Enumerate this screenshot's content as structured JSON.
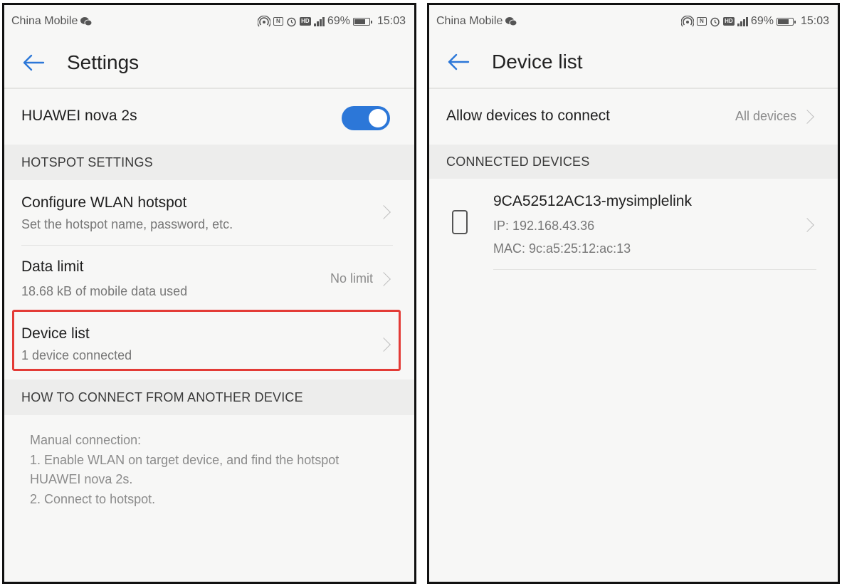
{
  "status_bar": {
    "carrier": "China Mobile",
    "battery_percent": "69%",
    "time": "15:03"
  },
  "left_screen": {
    "title": "Settings",
    "hotspot_name_row": {
      "label": "HUAWEI nova 2s",
      "toggle_on": true
    },
    "hotspot_settings_header": "HOTSPOT SETTINGS",
    "configure_wlan": {
      "title": "Configure WLAN hotspot",
      "subtitle": "Set the hotspot name, password, etc."
    },
    "data_limit": {
      "title": "Data limit",
      "subtitle": "18.68 kB of mobile data used",
      "value": "No limit"
    },
    "device_list": {
      "title": "Device list",
      "subtitle": "1 device connected"
    },
    "how_to_header": "HOW TO CONNECT FROM ANOTHER DEVICE",
    "instructions": [
      "Manual connection:",
      "1. Enable WLAN on target device, and find the hotspot",
      "HUAWEI nova 2s.",
      "2. Connect to hotspot."
    ]
  },
  "right_screen": {
    "title": "Device list",
    "allow_devices": {
      "label": "Allow devices to connect",
      "value": "All devices"
    },
    "connected_header": "CONNECTED DEVICES",
    "device": {
      "name": "9CA52512AC13-mysimplelink",
      "ip": "IP: 192.168.43.36",
      "mac": "MAC: 9c:a5:25:12:ac:13"
    }
  },
  "colors": {
    "accent": "#2c77d8",
    "highlight": "#e33b36"
  }
}
